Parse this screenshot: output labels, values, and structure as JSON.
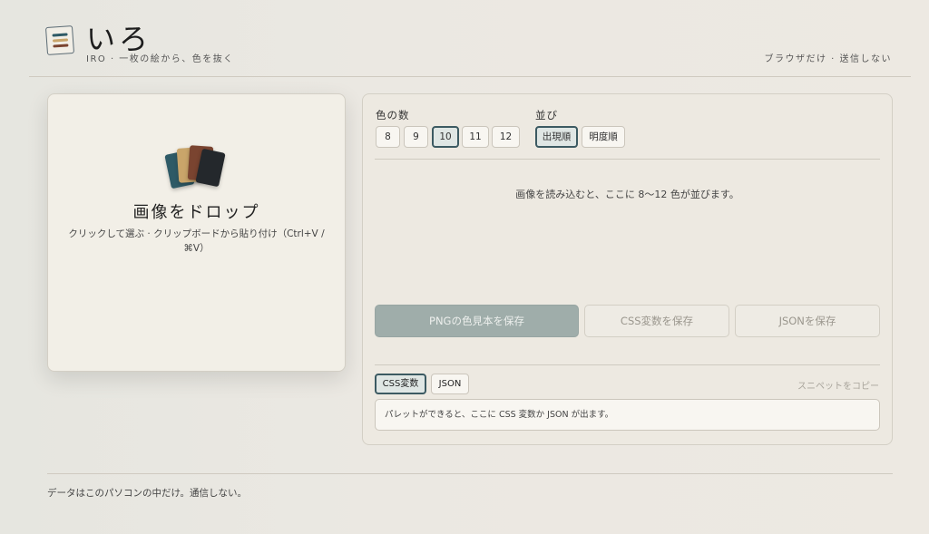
{
  "header": {
    "title": "いろ",
    "subtitle": "IRO · 一枚の絵から、色を抜く",
    "privacy_note": "ブラウザだけ · 送信しない"
  },
  "logo": {
    "icon": "palette-logo-icon",
    "colors": [
      "#2e5a66",
      "#c9a56a",
      "#7a4430"
    ]
  },
  "dropzone": {
    "icon": "color-cards-icon",
    "card_colors": [
      "#2e5a66",
      "#c9a56a",
      "#7a4430",
      "#24282c"
    ],
    "title": "画像をドロップ",
    "subtitle": "クリックして選ぶ · クリップボードから貼り付け（Ctrl+V / ⌘V）"
  },
  "controls": {
    "count_label": "色の数",
    "counts": [
      "8",
      "9",
      "10",
      "11",
      "12"
    ],
    "selected_count": "10",
    "order_label": "並び",
    "orders": [
      "出現順",
      "明度順"
    ],
    "selected_order": "出現順"
  },
  "palette": {
    "empty_message": "画像を読み込むと、ここに 8〜12 色が並びます。"
  },
  "actions": {
    "save_png": "PNGの色見本を保存",
    "save_css": "CSS変数を保存",
    "save_json": "JSONを保存"
  },
  "snippet": {
    "tabs": [
      "CSS変数",
      "JSON"
    ],
    "selected_tab": "CSS変数",
    "copy_label": "スニペットをコピー",
    "placeholder": "パレットができると、ここに CSS 変数か JSON が出ます。"
  },
  "footer": {
    "text": "データはこのパソコンの中だけ。通信しない。"
  },
  "colors": {
    "accent": "#3c5a62",
    "primary_button": "#9fadaa",
    "background": "#ebe8e1"
  }
}
